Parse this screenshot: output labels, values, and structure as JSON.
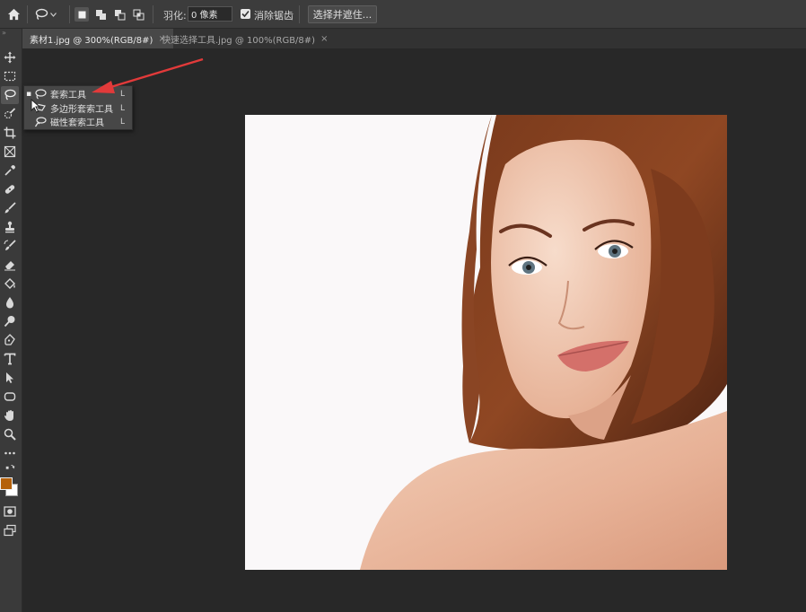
{
  "options_bar": {
    "home_icon": "home-icon",
    "tool_preset_icon": "lasso-icon",
    "selection_modes": [
      "new-selection",
      "add-to-selection",
      "subtract-from-selection",
      "intersect-with-selection"
    ],
    "feather_label": "羽化:",
    "feather_value": "0 像素",
    "anti_alias_label": "消除锯齿",
    "anti_alias_checked": true,
    "select_and_mask_label": "选择并遮住..."
  },
  "tabs": [
    {
      "label": "素材1.jpg @ 300%(RGB/8#)",
      "active": true,
      "close": "×"
    },
    {
      "label": "快速选择工具.jpg @ 100%(RGB/8#)",
      "active": false,
      "close": "×"
    }
  ],
  "toolbar": {
    "collapse": "»",
    "tools": [
      "move",
      "marquee",
      "lasso",
      "quick-select",
      "crop",
      "frame",
      "eyedropper",
      "healing",
      "brush",
      "stamp",
      "history-brush",
      "eraser",
      "paint-bucket",
      "blur",
      "dodge",
      "pen",
      "type",
      "path-select",
      "shape",
      "hand",
      "zoom",
      "more"
    ],
    "selected_tool": "lasso",
    "foreground_color": "#b4610b",
    "background_color": "#ffffff"
  },
  "flyout": {
    "items": [
      {
        "label": "套索工具",
        "key": "L",
        "active": true,
        "icon": "lasso-icon"
      },
      {
        "label": "多边形套索工具",
        "key": "L",
        "active": false,
        "icon": "polygonal-lasso-icon"
      },
      {
        "label": "磁性套索工具",
        "key": "L",
        "active": false,
        "icon": "magnetic-lasso-icon"
      }
    ]
  },
  "colors": {
    "annotation_arrow": "#e23a3a"
  }
}
